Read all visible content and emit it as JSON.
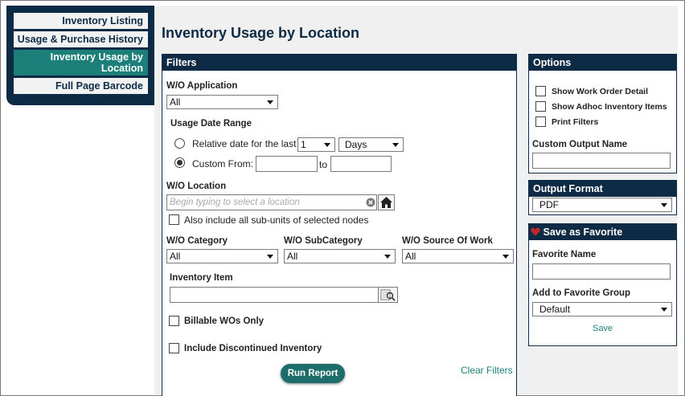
{
  "nav": {
    "items": [
      {
        "label": "Inventory Listing"
      },
      {
        "label": "Usage & Purchase History"
      },
      {
        "label": "Inventory Usage by Location",
        "active": true
      },
      {
        "label": "Full Page Barcode"
      }
    ]
  },
  "page_title": "Inventory Usage by Location",
  "filters": {
    "header": "Filters",
    "wo_application": {
      "label": "W/O Application",
      "value": "All"
    },
    "usage_date_range": {
      "label": "Usage Date Range",
      "relative_label": "Relative date for the last",
      "relative_count": "1",
      "relative_unit": "Days",
      "custom_label": "Custom From:",
      "to_label": "to",
      "selected": "custom"
    },
    "wo_location": {
      "label": "W/O Location",
      "placeholder": "Begin typing to select a location",
      "sub_units_label": "Also include all sub-units of selected nodes"
    },
    "wo_category": {
      "label": "W/O Category",
      "value": "All"
    },
    "wo_subcategory": {
      "label": "W/O SubCategory",
      "value": "All"
    },
    "wo_source": {
      "label": "W/O Source Of Work",
      "value": "All"
    },
    "inventory_item": {
      "label": "Inventory Item"
    },
    "billable_label": "Billable WOs Only",
    "discontinued_label": "Include Discontinued Inventory",
    "run_report": "Run Report",
    "clear_filters": "Clear Filters"
  },
  "options": {
    "header": "Options",
    "show_wo_detail": "Show Work Order Detail",
    "show_adhoc": "Show Adhoc Inventory Items",
    "print_filters": "Print Filters",
    "custom_output_name": "Custom Output Name"
  },
  "output_format": {
    "header": "Output Format",
    "value": "PDF"
  },
  "favorite": {
    "header": "Save as Favorite",
    "name_label": "Favorite Name",
    "group_label": "Add to Favorite Group",
    "group_value": "Default",
    "save": "Save"
  },
  "colors": {
    "navy": "#0d2b45",
    "teal": "#1d7f7a",
    "heart": "#c0282d"
  }
}
